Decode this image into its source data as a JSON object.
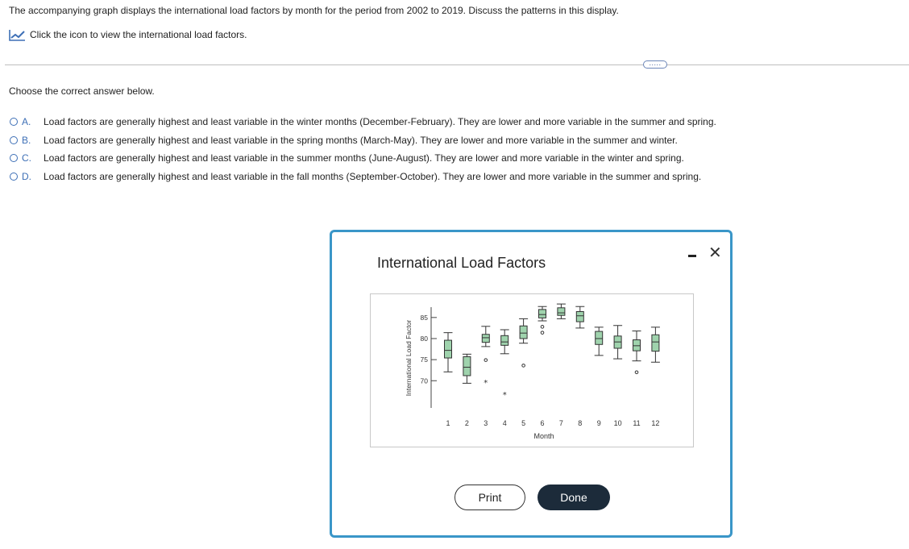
{
  "question": "The accompanying graph displays the international load factors by month for the period from 2002 to 2019. Discuss the patterns in this display.",
  "icon_link": {
    "icon": "line-chart-icon",
    "label": "Click the icon to view the international load factors."
  },
  "more_button": {
    "label": "....."
  },
  "choose_label": "Choose the correct answer below.",
  "options": [
    {
      "letter": "A.",
      "text": "Load factors are generally highest and least variable in the winter months (December-February). They are lower and more variable in the summer and spring."
    },
    {
      "letter": "B.",
      "text": "Load factors are generally highest and least variable in the spring months (March-May). They are lower and more variable in the summer and winter."
    },
    {
      "letter": "C.",
      "text": "Load factors are generally highest and least variable in the summer months (June-August). They are lower and more variable in the winter and spring."
    },
    {
      "letter": "D.",
      "text": "Load factors are generally highest and least variable in the fall months (September-October). They are lower and more variable in the summer and spring."
    }
  ],
  "modal": {
    "title": "International Load Factors",
    "print_label": "Print",
    "done_label": "Done",
    "minimize_icon": "minimize-icon",
    "close_icon": "close-icon"
  },
  "chart_data": {
    "type": "boxplot",
    "xlabel": "Month",
    "ylabel": "International Load Factor",
    "yticks": [
      70,
      75,
      80,
      85
    ],
    "ylim": [
      62.4,
      88.6
    ],
    "categories": [
      "1",
      "2",
      "3",
      "4",
      "5",
      "6",
      "7",
      "8",
      "9",
      "10",
      "11",
      "12"
    ],
    "boxes": [
      {
        "month": "1",
        "min": 72.1,
        "q1": 75.4,
        "median": 77.2,
        "q3": 79.6,
        "max": 81.4,
        "outliers": []
      },
      {
        "month": "2",
        "min": 69.4,
        "q1": 71.2,
        "median": 73.2,
        "q3": 75.7,
        "max": 76.3,
        "outliers": []
      },
      {
        "month": "3",
        "min": 78.1,
        "q1": 79.1,
        "median": 80.2,
        "q3": 81.0,
        "max": 82.9,
        "outliers": [
          {
            "value": 74.9,
            "marker": "o"
          },
          {
            "value": 69.7,
            "marker": "*"
          }
        ]
      },
      {
        "month": "4",
        "min": 76.4,
        "q1": 78.4,
        "median": 79.2,
        "q3": 80.7,
        "max": 82.1,
        "outliers": [
          {
            "value": 66.8,
            "marker": "*"
          }
        ]
      },
      {
        "month": "5",
        "min": 78.9,
        "q1": 80.0,
        "median": 81.3,
        "q3": 83.0,
        "max": 84.7,
        "outliers": [
          {
            "value": 73.6,
            "marker": "o"
          }
        ]
      },
      {
        "month": "6",
        "min": 84.2,
        "q1": 84.9,
        "median": 85.7,
        "q3": 86.9,
        "max": 87.6,
        "outliers": [
          {
            "value": 82.8,
            "marker": "o"
          },
          {
            "value": 81.4,
            "marker": "o"
          }
        ]
      },
      {
        "month": "7",
        "min": 84.7,
        "q1": 85.5,
        "median": 86.1,
        "q3": 87.3,
        "max": 88.2,
        "outliers": []
      },
      {
        "month": "8",
        "min": 82.5,
        "q1": 84.0,
        "median": 85.4,
        "q3": 86.4,
        "max": 87.6,
        "outliers": []
      },
      {
        "month": "9",
        "min": 76.0,
        "q1": 78.6,
        "median": 80.0,
        "q3": 81.7,
        "max": 82.7,
        "outliers": []
      },
      {
        "month": "10",
        "min": 75.2,
        "q1": 77.7,
        "median": 79.2,
        "q3": 80.6,
        "max": 83.1,
        "outliers": []
      },
      {
        "month": "11",
        "min": 74.7,
        "q1": 77.1,
        "median": 78.3,
        "q3": 79.7,
        "max": 81.8,
        "outliers": [
          {
            "value": 72.0,
            "marker": "o"
          }
        ]
      },
      {
        "month": "12",
        "min": 74.4,
        "q1": 77.0,
        "median": 79.2,
        "q3": 80.9,
        "max": 82.7,
        "outliers": []
      }
    ],
    "colors": {
      "box_fill": "#9fd3ad",
      "box_stroke": "#333333"
    }
  },
  "colors": {
    "accent": "#3d6fb6",
    "modal_border": "#3a96c8",
    "done_bg": "#1c2b3a"
  }
}
